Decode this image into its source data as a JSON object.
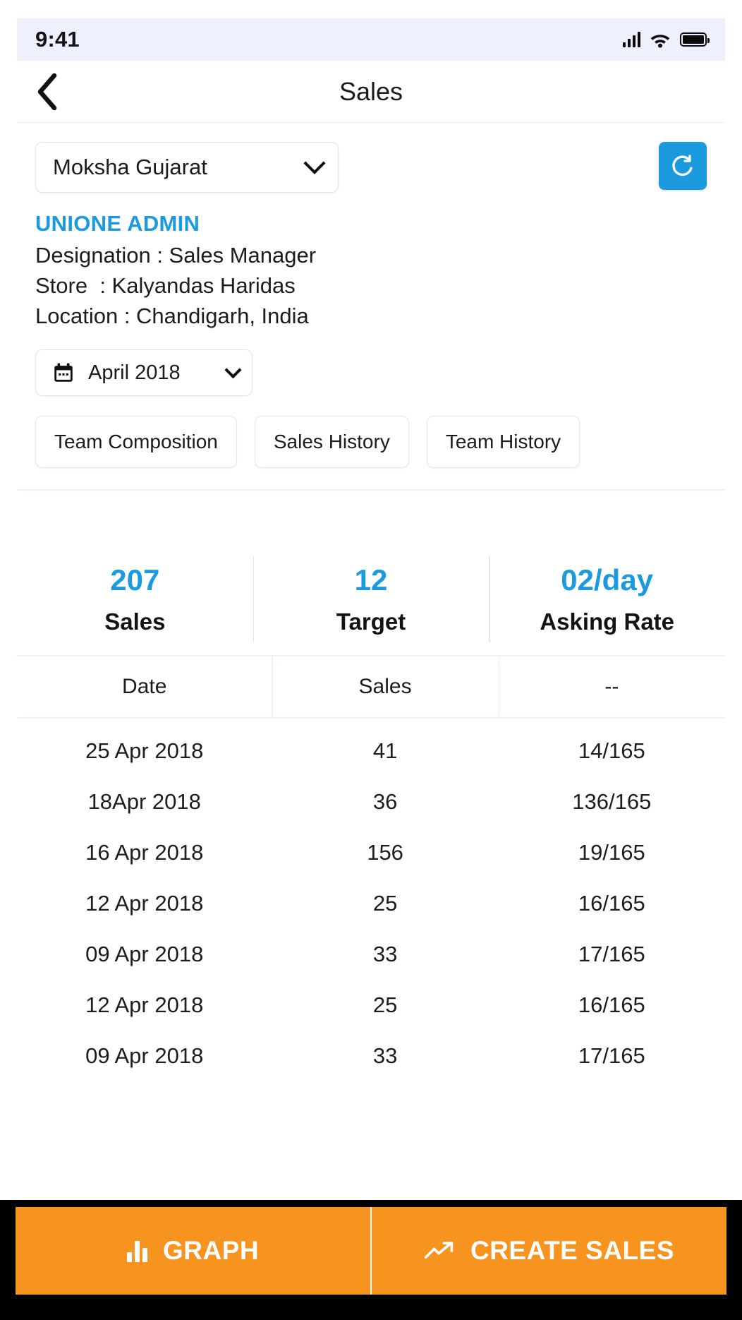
{
  "status_bar": {
    "time": "9:41",
    "icons": [
      "signal-icon",
      "wifi-icon",
      "battery-icon"
    ]
  },
  "header": {
    "title": "Sales",
    "back_icon": "chevron-left-icon"
  },
  "filters": {
    "region_select": {
      "value": "Moksha Gujarat",
      "chevron_icon": "chevron-down-icon"
    },
    "refresh_button": {
      "icon": "refresh-icon",
      "color": "#1b9ae0"
    },
    "date_select": {
      "value": "April 2018",
      "calendar_icon": "calendar-icon",
      "chevron_icon": "chevron-down-icon"
    },
    "tabs": [
      {
        "label": "Team Composition"
      },
      {
        "label": "Sales History"
      },
      {
        "label": "Team History"
      }
    ]
  },
  "user_info": {
    "name": "UNIONE ADMIN",
    "name_color": "#1b9ae0",
    "designation": "Designation : Sales Manager",
    "store": "Store  : Kalyandas Haridas",
    "location": "Location : Chandigarh, India"
  },
  "stats": [
    {
      "value": "207",
      "label": "Sales"
    },
    {
      "value": "12",
      "label": "Target"
    },
    {
      "value": "02/day",
      "label": "Asking Rate"
    }
  ],
  "table": {
    "headers": [
      "Date",
      "Sales",
      "--"
    ],
    "rows": [
      {
        "date": "25 Apr 2018",
        "sales": "41",
        "ratio": "14/165"
      },
      {
        "date": "18Apr 2018",
        "sales": "36",
        "ratio": "136/165"
      },
      {
        "date": "16 Apr 2018",
        "sales": "156",
        "ratio": "19/165"
      },
      {
        "date": "12 Apr 2018",
        "sales": "25",
        "ratio": "16/165"
      },
      {
        "date": "09 Apr 2018",
        "sales": "33",
        "ratio": "17/165"
      },
      {
        "date": "12 Apr 2018",
        "sales": "25",
        "ratio": "16/165"
      },
      {
        "date": "09 Apr 2018",
        "sales": "33",
        "ratio": "17/165"
      }
    ]
  },
  "bottom_actions": [
    {
      "label": "GRAPH",
      "icon": "bar-chart-icon",
      "color": "#f79420"
    },
    {
      "label": "CREATE SALES",
      "icon": "trending-up-icon",
      "color": "#f79420"
    }
  ]
}
